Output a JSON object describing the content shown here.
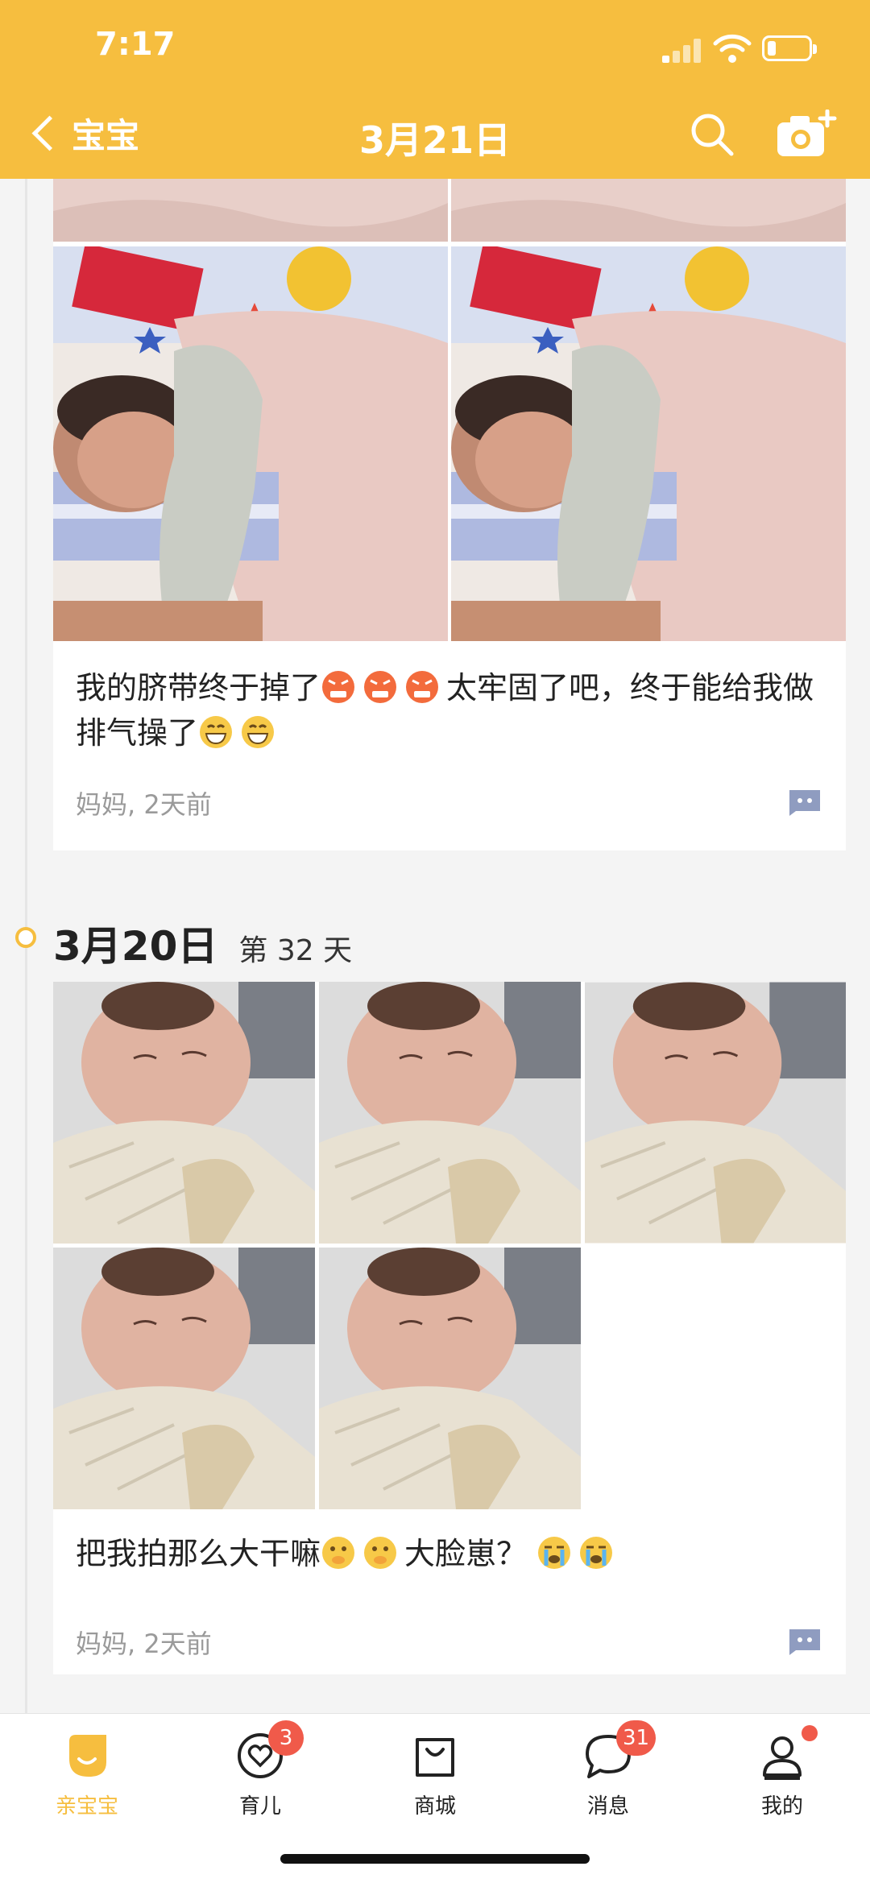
{
  "status_bar": {
    "time": "7:17"
  },
  "header": {
    "back_label": "宝宝",
    "title": "3月21日"
  },
  "posts": [
    {
      "text_parts": [
        "我的脐带终于掉了",
        "太牢固了吧，终于能给我做排气操了"
      ],
      "text_emojis": [
        "angry-emoji",
        "angry-emoji",
        "angry-emoji",
        "grin-emoji",
        "grin-emoji"
      ],
      "author_time": "妈妈, 2天前"
    },
    {
      "date": "3月20日",
      "day": "第 32 天",
      "text_parts": [
        "把我拍那么大干嘛",
        "大脸崽？"
      ],
      "text_emojis": [
        "shush-emoji",
        "shush-emoji",
        "crying-emoji",
        "crying-emoji"
      ],
      "author_time": "妈妈, 2天前"
    }
  ],
  "tabbar": {
    "tabs": [
      {
        "label": "亲宝宝",
        "icon": "baby-face-icon",
        "active": true
      },
      {
        "label": "育儿",
        "icon": "heart-icon",
        "badge": "3"
      },
      {
        "label": "商城",
        "icon": "shopping-bag-icon"
      },
      {
        "label": "消息",
        "icon": "chat-bubble-icon",
        "badge": "31"
      },
      {
        "label": "我的",
        "icon": "person-icon",
        "dot": true
      }
    ]
  },
  "colors": {
    "accent": "#F6BE3F",
    "badge": "#F05A4A"
  }
}
